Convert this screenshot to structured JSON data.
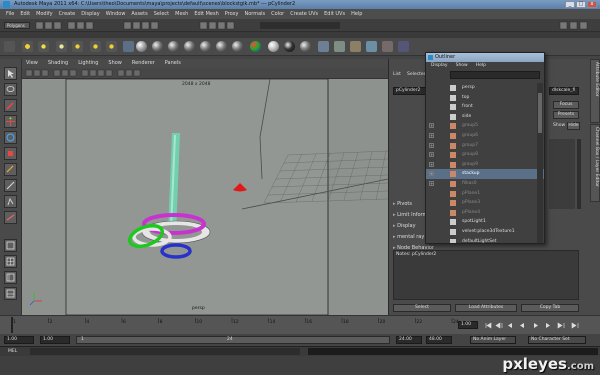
{
  "window": {
    "title": "Autodesk Maya 2011 x64: C:\\Users\\theo\\Documents\\maya\\projects\\default\\scenes\\blockstgik.mb* --- pCylinder2",
    "minimize": "_",
    "maximize": "□",
    "close": "x"
  },
  "menubar": [
    "File",
    "Edit",
    "Modify",
    "Create",
    "Display",
    "Window",
    "Assets",
    "Select",
    "Mesh",
    "Edit Mesh",
    "Proxy",
    "Normals",
    "Color",
    "Create UVs",
    "Edit UVs",
    "Help"
  ],
  "statusline": {
    "mode": "Polygons"
  },
  "viewport": {
    "menu": [
      "View",
      "Shading",
      "Lighting",
      "Show",
      "Renderer",
      "Panels"
    ],
    "resolution": "2048 x 2048",
    "camera": "persp"
  },
  "outliner": {
    "title": "Outliner",
    "menu": [
      "Display",
      "Show",
      "Help"
    ],
    "items": [
      {
        "label": "persp",
        "dim": false,
        "selected": false,
        "expand": false
      },
      {
        "label": "top",
        "dim": false,
        "selected": false,
        "expand": false
      },
      {
        "label": "front",
        "dim": false,
        "selected": false,
        "expand": false
      },
      {
        "label": "side",
        "dim": false,
        "selected": false,
        "expand": false
      },
      {
        "label": "group5",
        "dim": true,
        "selected": false,
        "expand": true
      },
      {
        "label": "group6",
        "dim": true,
        "selected": false,
        "expand": true
      },
      {
        "label": "group7",
        "dim": true,
        "selected": false,
        "expand": true
      },
      {
        "label": "group8",
        "dim": true,
        "selected": false,
        "expand": true
      },
      {
        "label": "group9",
        "dim": true,
        "selected": false,
        "expand": true
      },
      {
        "label": "stackup",
        "dim": false,
        "selected": true,
        "expand": true
      },
      {
        "label": "filkas0",
        "dim": true,
        "selected": false,
        "expand": true
      },
      {
        "label": "pPlane1",
        "dim": true,
        "selected": false,
        "expand": false
      },
      {
        "label": "pPlane3",
        "dim": true,
        "selected": false,
        "expand": false
      },
      {
        "label": "pPlane4",
        "dim": true,
        "selected": false,
        "expand": false
      },
      {
        "label": "spotLight1",
        "dim": false,
        "selected": false,
        "expand": false
      },
      {
        "label": "velvet:place3dTexture1",
        "dim": false,
        "selected": false,
        "expand": false
      },
      {
        "label": "defaultLightSet",
        "dim": false,
        "selected": false,
        "expand": false
      }
    ]
  },
  "channelbox": {
    "tabs": [
      "List",
      "Selected"
    ],
    "node": "pCylinder2",
    "node2": "dlskcale_fi",
    "focus": "Focus",
    "presets": "Presets",
    "show": "Show",
    "hide": "Hide",
    "attr_sections": [
      "Pivots",
      "Limit Information",
      "Display",
      "mental ray",
      "Node Behavior"
    ],
    "notes": "Notes: pCylinder2",
    "buttons": [
      "Select",
      "Load Attributes",
      "Copy Tab"
    ],
    "side_tabs": [
      "Attribute Editor",
      "Channel Box / Layer Editor"
    ]
  },
  "timeslider": {
    "ticks": [
      "1",
      "2",
      "4",
      "6",
      "8",
      "10",
      "12",
      "14",
      "16",
      "18",
      "20",
      "22",
      "24"
    ],
    "current": "1.00"
  },
  "range": {
    "start": "1.00",
    "start2": "1.00",
    "range_start": "1",
    "range_end": "24",
    "end": "24.00",
    "end2": "48.00",
    "anim_layer": "No Anim Layer",
    "char_set": "No Character Set"
  },
  "cmdline": {
    "label": "MEL"
  },
  "watermark": {
    "name": "pxleyes",
    "suffix": ".com"
  },
  "colors": {
    "accent": "#5b7fa7",
    "ring_magenta": "#c832d0",
    "ring_green": "#1ec81e",
    "ring_blue": "#2832c8",
    "cone_red": "#e01818",
    "cylinder": "#6fd6b0"
  }
}
